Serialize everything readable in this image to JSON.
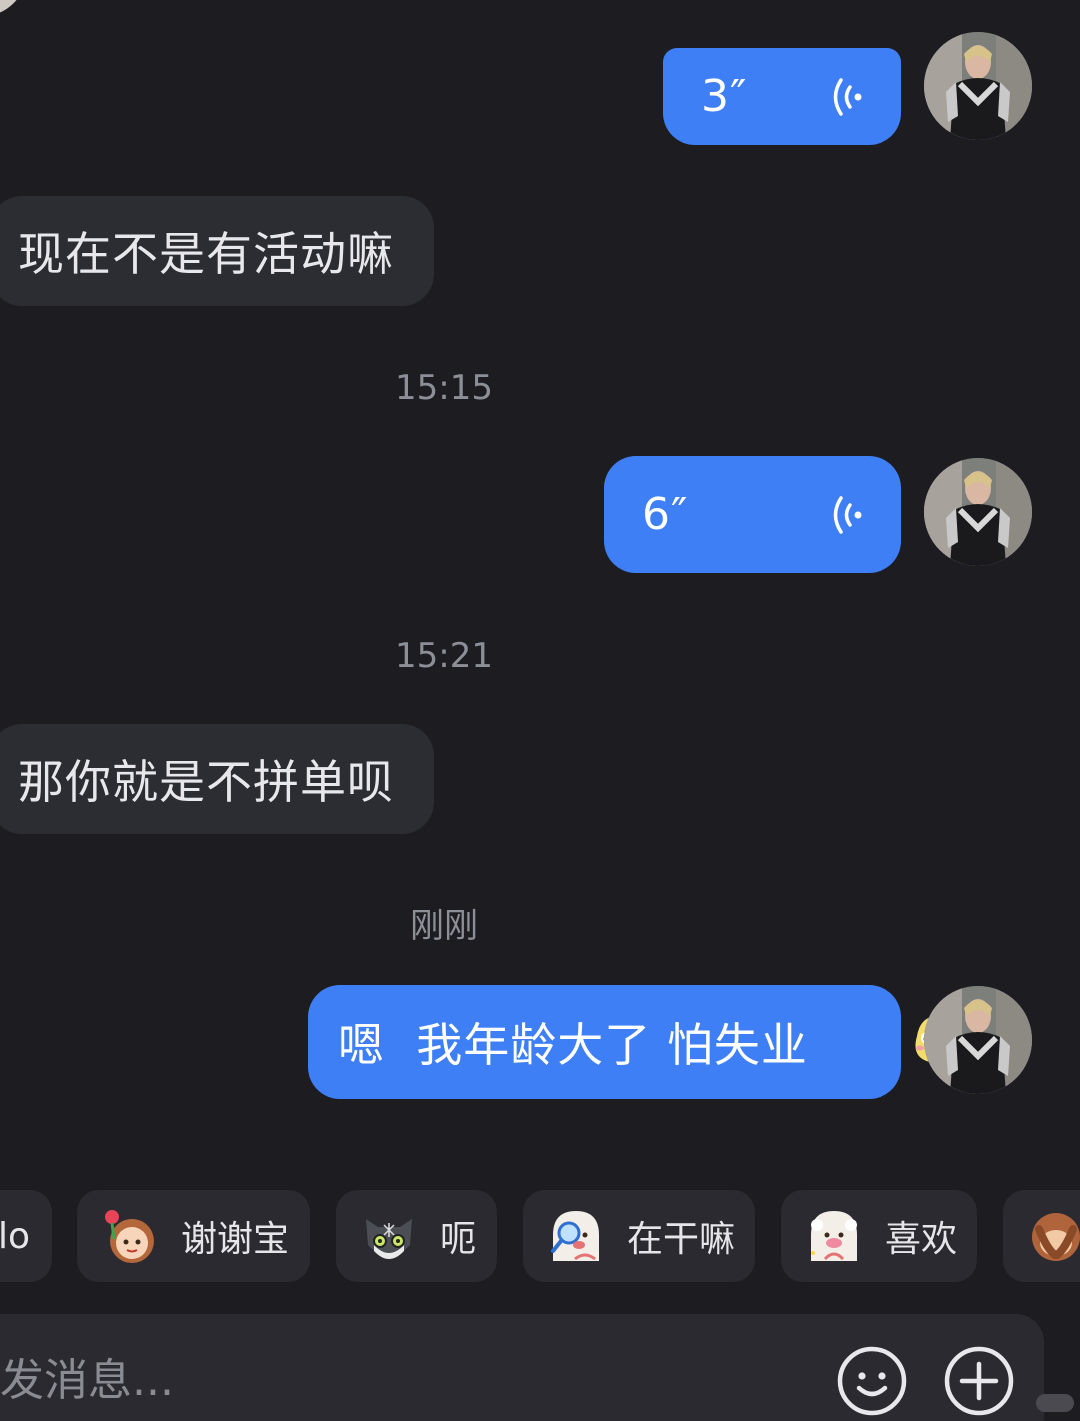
{
  "messages": {
    "voice_1": {
      "duration": "3″"
    },
    "text_in_1": "现在不是有活动嘛",
    "time_1": "15:15",
    "voice_2": {
      "duration": "6″"
    },
    "time_2": "15:21",
    "text_in_2": "那你就是不拼单呗",
    "time_3": "刚刚",
    "text_out_1": "嗯  我年龄大了 怕失业"
  },
  "quick_replies": [
    {
      "label": "lo"
    },
    {
      "label": "谢谢宝"
    },
    {
      "label": "呃"
    },
    {
      "label": "在干嘛"
    },
    {
      "label": "喜欢"
    }
  ],
  "composer": {
    "placeholder": "发消息..."
  },
  "icons": {
    "voice": "voice-wave-icon",
    "emoji": "smiley-icon",
    "plus": "plus-circle-icon"
  },
  "colors": {
    "background": "#1c1c21",
    "incoming_bubble": "#2c2c33",
    "outgoing_bubble": "#3f7ff5",
    "timestamp": "#8d8f98"
  }
}
